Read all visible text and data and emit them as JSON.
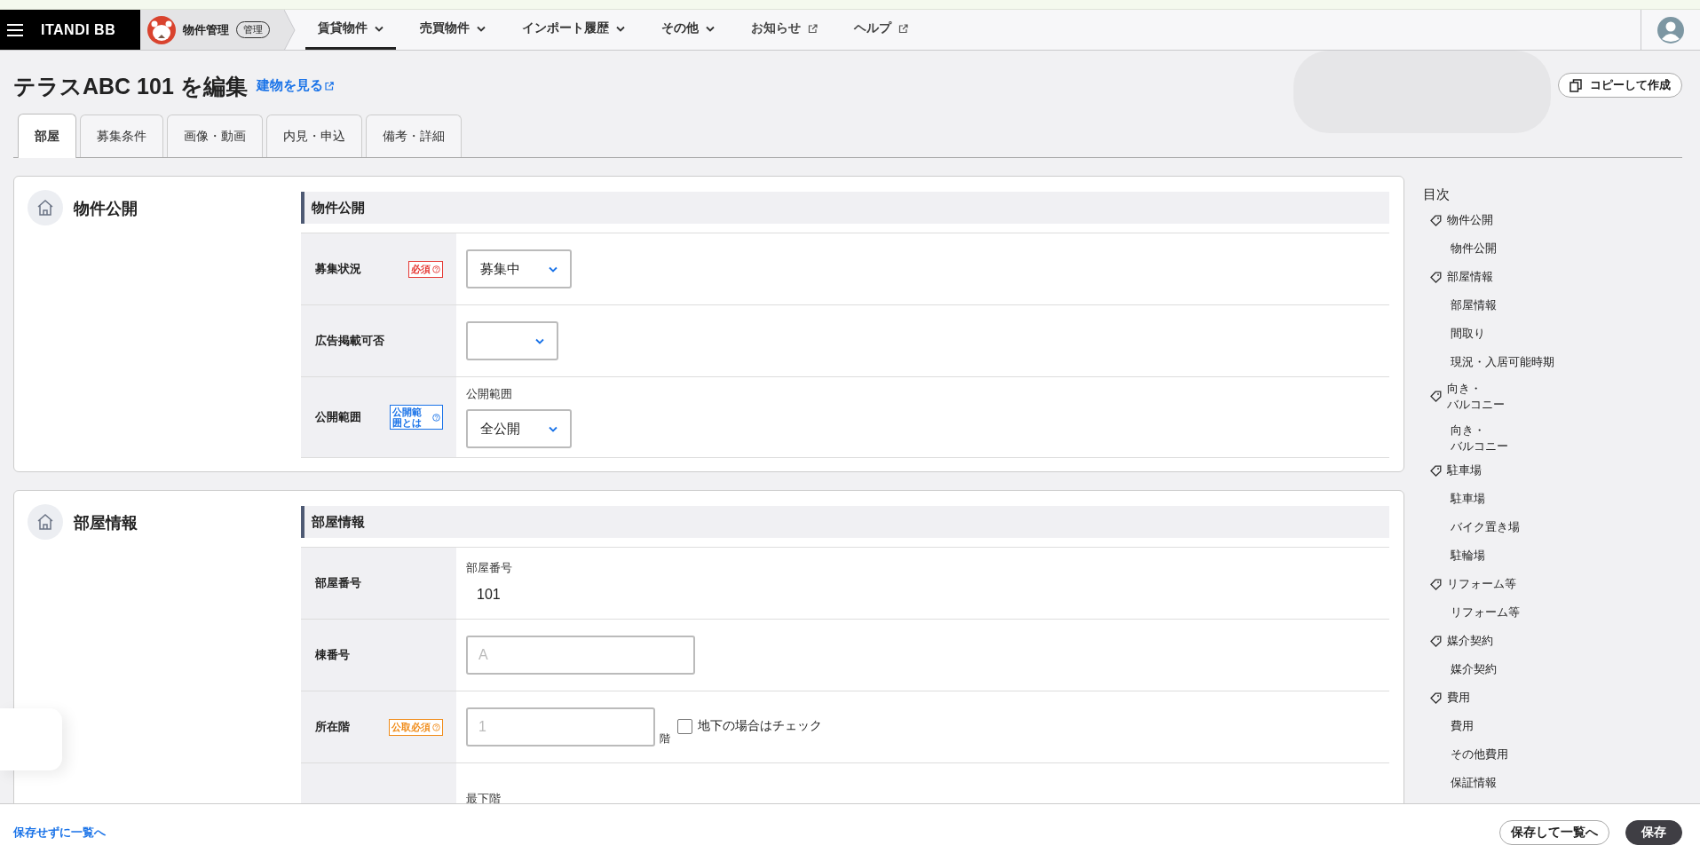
{
  "nav": {
    "brand": "ITANDI BB",
    "app": "物件管理",
    "app_badge": "管理",
    "items": [
      {
        "label": "賃貸物件",
        "kind": "dropdown",
        "selected": true
      },
      {
        "label": "売買物件",
        "kind": "dropdown",
        "selected": false
      },
      {
        "label": "インポート履歴",
        "kind": "dropdown",
        "selected": false
      },
      {
        "label": "その他",
        "kind": "dropdown",
        "selected": false
      },
      {
        "label": "お知らせ",
        "kind": "external",
        "selected": false
      },
      {
        "label": "ヘルプ",
        "kind": "external",
        "selected": false
      }
    ]
  },
  "page": {
    "title": "テラスABC 101 を編集",
    "link": "建物を見る",
    "copy_button": "コピーして作成"
  },
  "tabs": [
    {
      "label": "部屋",
      "selected": true
    },
    {
      "label": "募集条件",
      "selected": false
    },
    {
      "label": "画像・動画",
      "selected": false
    },
    {
      "label": "内見・申込",
      "selected": false
    },
    {
      "label": "備考・詳細",
      "selected": false
    }
  ],
  "sections": [
    {
      "title": "物件公開",
      "subtitle": "物件公開",
      "rows": [
        {
          "label": "募集状況",
          "badge": {
            "text": "必須",
            "kind": "required"
          },
          "field": {
            "kind": "select",
            "value": "募集中"
          }
        },
        {
          "label": "広告掲載可否",
          "field": {
            "kind": "select"
          }
        },
        {
          "label": "公開範囲",
          "badge": {
            "text": "公開範囲とは",
            "kind": "info"
          },
          "caption": "公開範囲",
          "field": {
            "kind": "select",
            "value": "全公開"
          }
        }
      ]
    },
    {
      "title": "部屋情報",
      "subtitle": "部屋情報",
      "rows": [
        {
          "label": "部屋番号",
          "caption": "部屋番号",
          "field": {
            "kind": "text",
            "value": "101"
          }
        },
        {
          "label": "棟番号",
          "field": {
            "kind": "input",
            "placeholder": "A"
          }
        },
        {
          "label": "所在階",
          "badge": {
            "text": "公取必須",
            "kind": "fair"
          },
          "field": {
            "kind": "input",
            "placeholder": "1",
            "unit": "階",
            "checkbox": {
              "label": "地下の場合はチェック",
              "checked": false
            }
          }
        },
        {
          "caption": "最下階"
        }
      ]
    }
  ],
  "toc": {
    "title": "目次",
    "items": [
      {
        "label": "物件公開",
        "children": [
          {
            "label": "物件公開"
          }
        ]
      },
      {
        "label": "部屋情報",
        "children": [
          {
            "label": "部屋情報"
          },
          {
            "label": "間取り"
          },
          {
            "label": "現況・入居可能時期"
          }
        ]
      },
      {
        "lines": [
          "向き・",
          "バルコニー"
        ],
        "children": [
          {
            "lines": [
              "向き・",
              "バルコニー"
            ]
          }
        ]
      },
      {
        "label": "駐車場",
        "children": [
          {
            "label": "駐車場"
          },
          {
            "label": "バイク置き場"
          },
          {
            "label": "駐輪場"
          }
        ]
      },
      {
        "label": "リフォーム等",
        "children": [
          {
            "label": "リフォーム等"
          }
        ]
      },
      {
        "label": "媒介契約",
        "children": [
          {
            "label": "媒介契約"
          }
        ]
      },
      {
        "label": "費用",
        "children": [
          {
            "label": "費用"
          },
          {
            "label": "その他費用"
          },
          {
            "label": "保証情報"
          }
        ]
      }
    ]
  },
  "footer": {
    "link": "保存せずに一覧へ",
    "buttons": [
      {
        "label": "保存して一覧へ",
        "kind": "secondary"
      },
      {
        "label": "保存",
        "kind": "primary"
      }
    ]
  }
}
